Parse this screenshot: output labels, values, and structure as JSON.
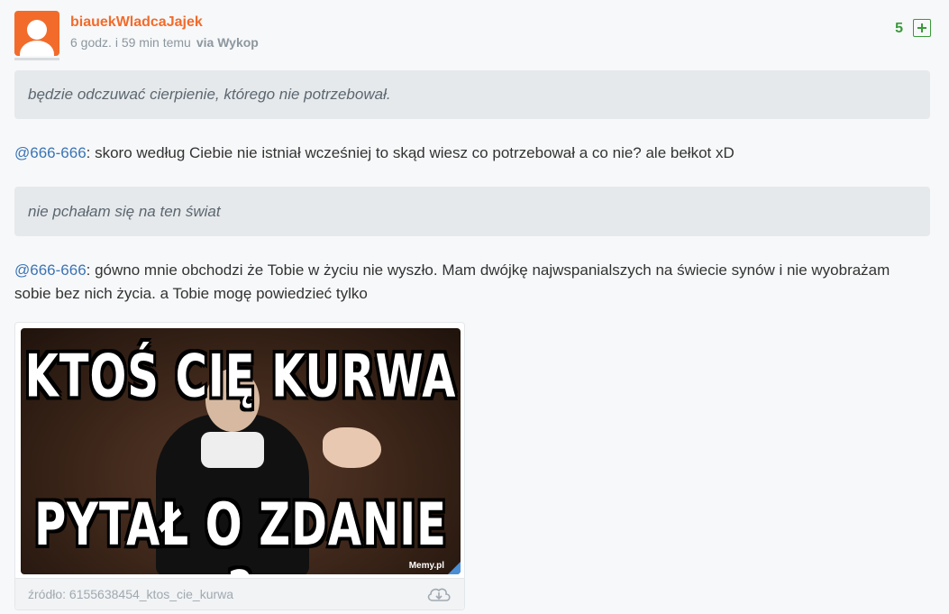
{
  "post": {
    "author": "biauekWladcaJajek",
    "time": "6 godz. i 59 min temu",
    "via": "via Wykop",
    "votes": "5"
  },
  "content": {
    "quote1": "będzie odczuwać cierpienie, którego nie potrzebował.",
    "reply1": {
      "mention": "@666-666",
      "text": ": skoro według Ciebie nie istniał wcześniej to skąd wiesz co potrzebował a co nie? ale bełkot xD"
    },
    "quote2": "nie pchałam się na ten świat",
    "reply2": {
      "mention": "@666-666",
      "text": ": gówno mnie obchodzi że Tobie w życiu nie wyszło. Mam dwójkę najwspanialszych na świecie synów i nie wyobrażam sobie bez nich życia. a Tobie mogę powiedzieć tylko"
    }
  },
  "embed": {
    "meme_top": "KTOŚ CIĘ KURWA",
    "meme_bottom": "PYTAŁ O ZDANIE ?",
    "watermark": "Memy.pl",
    "source": "źródło: 6155638454_ktos_cie_kurwa",
    "download_icon": "cloud-download-icon"
  },
  "colors": {
    "accent": "#f26b2b",
    "vote_green": "#3a9a3a",
    "mention": "#3b74b6",
    "quote_bg": "#e6e9ec"
  }
}
